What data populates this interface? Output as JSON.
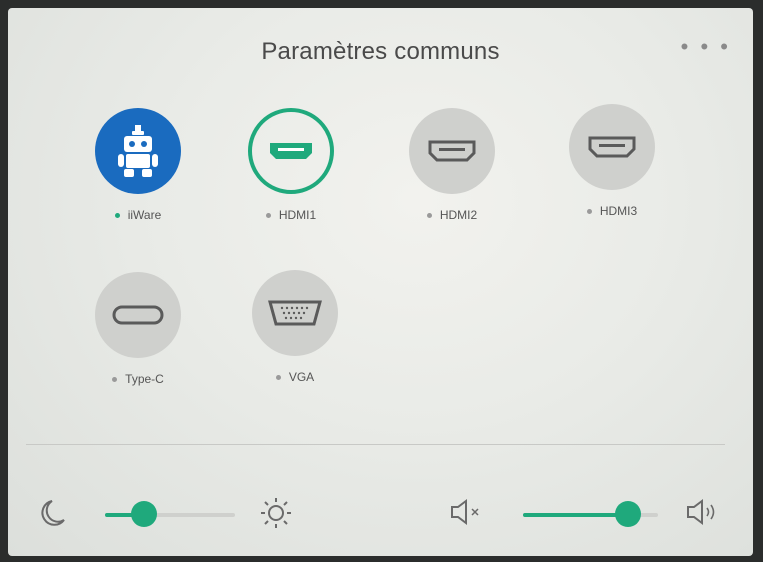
{
  "header": {
    "title": "Paramètres communs",
    "more_label": "• • •"
  },
  "sources": [
    {
      "label": "iiWare",
      "icon": "android-icon",
      "state": "active"
    },
    {
      "label": "HDMI1",
      "icon": "hdmi-icon",
      "state": "selected"
    },
    {
      "label": "HDMI2",
      "icon": "hdmi-icon",
      "state": "normal"
    },
    {
      "label": "HDMI3",
      "icon": "hdmi-icon",
      "state": "normal"
    },
    {
      "label": "Type-C",
      "icon": "type-c-icon",
      "state": "normal"
    },
    {
      "label": "VGA",
      "icon": "vga-icon",
      "state": "normal"
    }
  ],
  "brightness": {
    "level": 0.3,
    "icon_low": "moon-icon",
    "icon_high": "sun-icon"
  },
  "volume": {
    "level": 0.78,
    "icon_mute": "speaker-mute-icon",
    "icon_loud": "speaker-loud-icon"
  },
  "colors": {
    "accent": "#1fa97c",
    "active_blue": "#1a6bbf"
  }
}
